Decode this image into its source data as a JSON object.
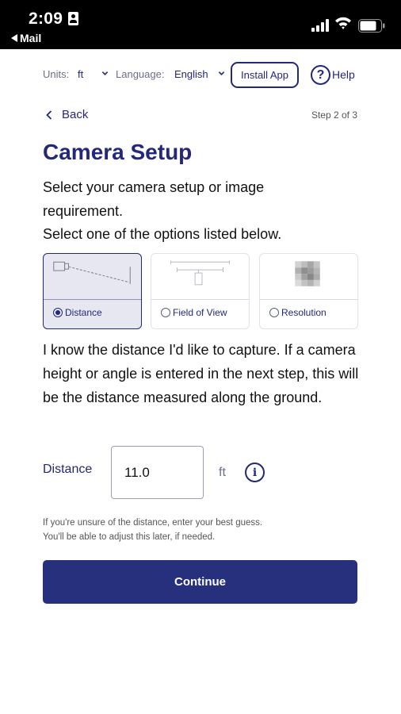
{
  "status_bar": {
    "time": "2:09",
    "back_app": "Mail"
  },
  "toolbar": {
    "units_label": "Units:",
    "units_value": "ft",
    "language_label": "Language:",
    "language_value": "English",
    "install_label": "Install App",
    "help_symbol": "?",
    "help_label": "Help"
  },
  "nav": {
    "back_label": "Back",
    "step_label": "Step 2 of 3"
  },
  "page": {
    "title": "Camera Setup",
    "intro_line1": "Select your camera setup or image",
    "intro_line2": "requirement.",
    "intro_line3": "Select one of the options listed below."
  },
  "options": [
    {
      "label": "Distance",
      "selected": true,
      "icon": "distance-diagram-icon"
    },
    {
      "label": "Field of View",
      "selected": false,
      "icon": "field-of-view-diagram-icon"
    },
    {
      "label": "Resolution",
      "selected": false,
      "icon": "pixel-resolution-icon"
    }
  ],
  "description": "I know the distance I'd like to capture. If a camera height or angle is entered in the next step, this will be the distance measured along the ground.",
  "distance": {
    "label": "Distance",
    "value": "11.0",
    "unit": "ft",
    "info_symbol": "i"
  },
  "hint": {
    "line1": "If you're unsure of the distance, enter your best guess.",
    "line2": "You'll be able to adjust this later, if needed."
  },
  "continue_label": "Continue",
  "colors": {
    "primary": "#23287a",
    "button": "#27307c",
    "selected_bg": "#e6e7f1"
  }
}
